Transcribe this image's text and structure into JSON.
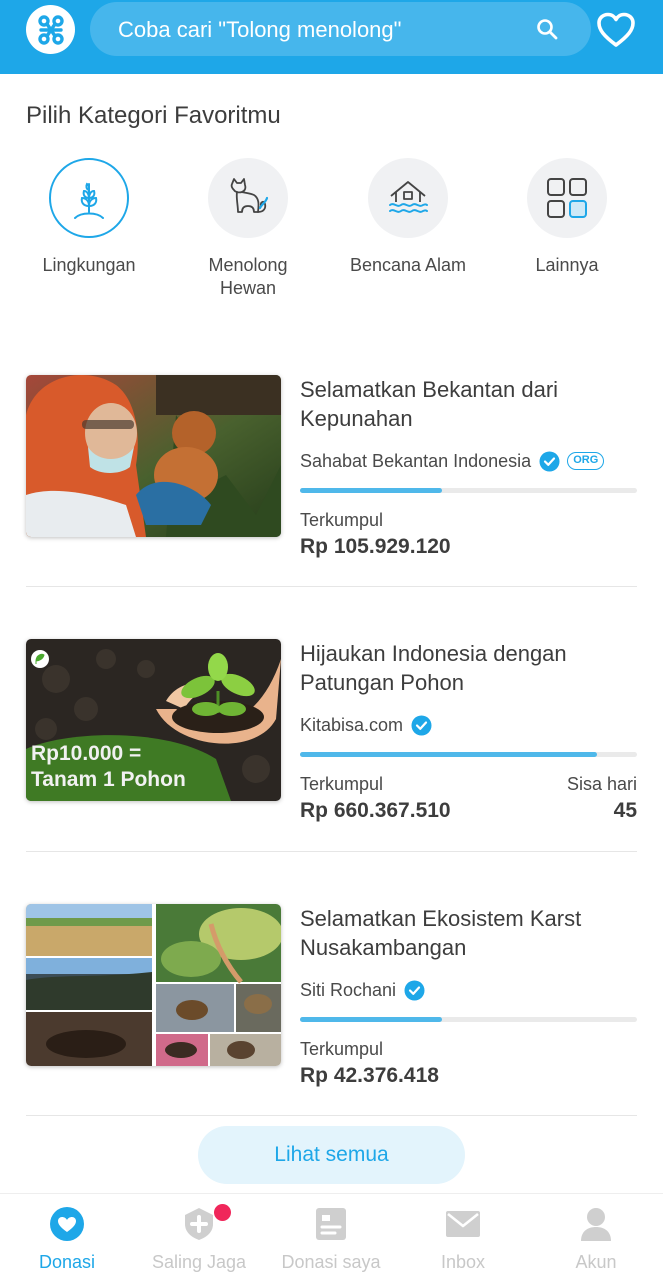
{
  "colors": {
    "brand": "#1ea7e8",
    "progress": "#4fb8ea",
    "notification": "#f0265a",
    "inactive_nav": "#c8c8c8"
  },
  "header": {
    "logo_icon": "kitabisa-logo-icon",
    "search_placeholder": "Coba cari \"Tolong menolong\"",
    "search_icon": "search-icon",
    "favorite_icon": "heart-outline-icon"
  },
  "categories": {
    "title": "Pilih Kategori Favoritmu",
    "items": [
      {
        "label": "Lingkungan",
        "icon": "plant-icon",
        "selected": true
      },
      {
        "label": "Menolong Hewan",
        "icon": "cat-icon",
        "selected": false
      },
      {
        "label": "Bencana Alam",
        "icon": "flood-house-icon",
        "selected": false
      },
      {
        "label": "Lainnya",
        "icon": "grid-icon",
        "selected": false
      }
    ]
  },
  "campaigns": [
    {
      "title": "Selamatkan Bekantan dari Kepunahan",
      "organizer": "Sahabat Bekantan Indonesia",
      "verified": true,
      "badge": "ORG",
      "progress": 0.42,
      "collected_label": "Terkumpul",
      "collected_amount": "Rp 105.929.120"
    },
    {
      "title": "Hijaukan Indonesia dengan Patungan Pohon",
      "organizer": "Kitabisa.com",
      "verified": true,
      "image_text_line1": "Rp10.000 =",
      "image_text_line2": "Tanam 1 Pohon",
      "progress": 0.88,
      "collected_label": "Terkumpul",
      "collected_amount": "Rp 660.367.510",
      "days_label": "Sisa hari",
      "days_value": "45"
    },
    {
      "title": "Selamatkan Ekosistem Karst Nusakambangan",
      "organizer": "Siti Rochani",
      "verified": true,
      "progress": 0.42,
      "collected_label": "Terkumpul",
      "collected_amount": "Rp 42.376.418"
    }
  ],
  "see_all_label": "Lihat semua",
  "bottom_nav": [
    {
      "label": "Donasi",
      "icon": "heart-circle-icon",
      "active": true
    },
    {
      "label": "Saling Jaga",
      "icon": "plus-shield-icon",
      "active": false,
      "notification": true
    },
    {
      "label": "Donasi saya",
      "icon": "document-icon",
      "active": false
    },
    {
      "label": "Inbox",
      "icon": "mail-icon",
      "active": false
    },
    {
      "label": "Akun",
      "icon": "user-icon",
      "active": false
    }
  ]
}
